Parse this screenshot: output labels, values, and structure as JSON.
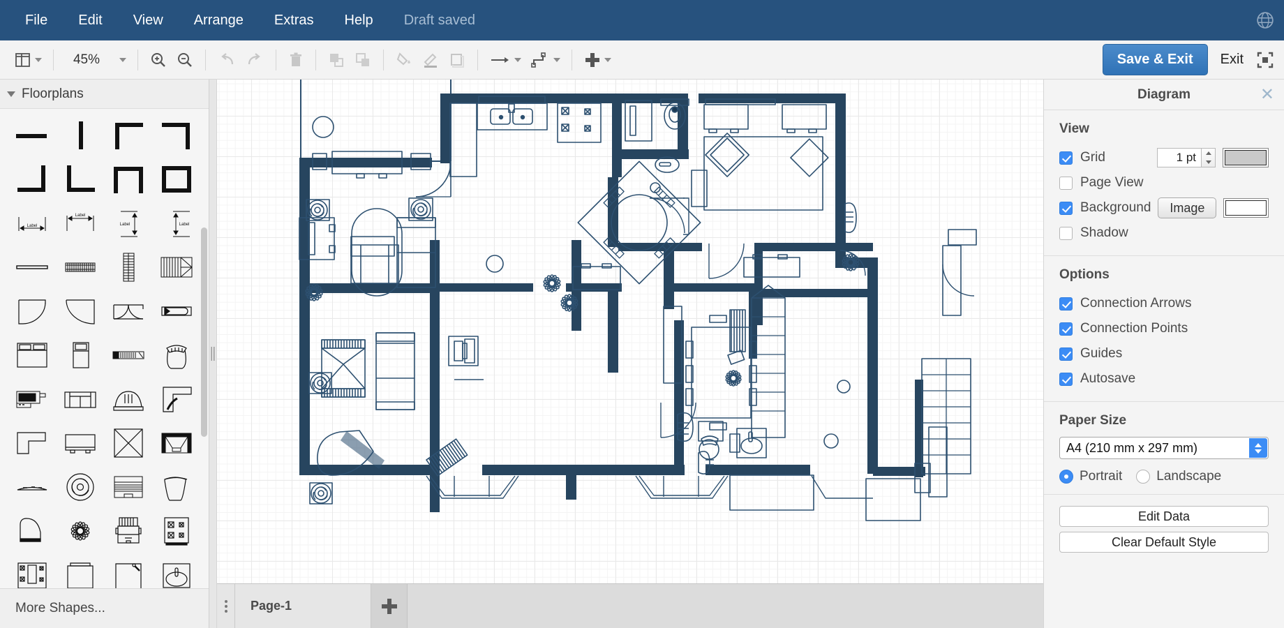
{
  "menu": {
    "items": [
      "File",
      "Edit",
      "View",
      "Arrange",
      "Extras",
      "Help"
    ],
    "status": "Draft saved",
    "globe_icon": "globe-icon"
  },
  "toolbar": {
    "view_icon": "layout-panel-icon",
    "zoom_level": "45%",
    "zoom_in_icon": "zoom-in-icon",
    "zoom_out_icon": "zoom-out-icon",
    "undo_icon": "undo-icon",
    "redo_icon": "redo-icon",
    "delete_icon": "trash-icon",
    "to_front_icon": "bring-to-front-icon",
    "to_back_icon": "send-to-back-icon",
    "fill_icon": "fill-color-icon",
    "line_icon": "line-color-icon",
    "shadow_icon": "shape-style-icon",
    "connection_icon": "connection-arrow-icon",
    "waypoint_icon": "waypoint-icon",
    "insert_icon": "plus-icon",
    "save_exit_label": "Save & Exit",
    "exit_label": "Exit",
    "fullscreen_icon": "fullscreen-icon"
  },
  "sidebar": {
    "palette_title": "Floorplans",
    "more_shapes_label": "More Shapes...",
    "shapes": [
      "wall-horizontal",
      "wall-vertical",
      "wall-corner-left",
      "wall-corner-right",
      "wall-corner-bottom-left",
      "wall-corner-bottom-right",
      "wall-u-shape",
      "wall-room",
      "dimension-bottom",
      "dimension-top",
      "dimension-left",
      "dimension-right",
      "wall-thin",
      "stairs-small",
      "stairs-tall",
      "stairs-winder",
      "door-quarter",
      "door-arc",
      "door-double",
      "window-sliding",
      "bed-double",
      "bed-single",
      "sofa-long",
      "chair-round",
      "tv-stand",
      "sofa-two-seat",
      "armchair",
      "counter-corner",
      "desk-corner",
      "tv-flat",
      "table-square",
      "sofa-sectional",
      "table-low",
      "fan-ceiling",
      "piano-upright",
      "chair-wide",
      "piano-grand",
      "plant-flower",
      "printer",
      "stove-top",
      "kitchen-unit",
      "cabinet",
      "sink-corner",
      "sink-basin"
    ]
  },
  "right_panel": {
    "title": "Diagram",
    "close_icon": "close-icon",
    "view": {
      "heading": "View",
      "grid_label": "Grid",
      "grid_checked": true,
      "grid_size": "1 pt",
      "grid_color": "#c9c9c9",
      "page_view_label": "Page View",
      "page_view_checked": false,
      "background_label": "Background",
      "background_checked": true,
      "background_image_label": "Image",
      "background_color": "#ffffff",
      "shadow_label": "Shadow",
      "shadow_checked": false
    },
    "options": {
      "heading": "Options",
      "items": [
        {
          "label": "Connection Arrows",
          "checked": true
        },
        {
          "label": "Connection Points",
          "checked": true
        },
        {
          "label": "Guides",
          "checked": true
        },
        {
          "label": "Autosave",
          "checked": true
        }
      ]
    },
    "paper": {
      "heading": "Paper Size",
      "selected": "A4 (210 mm x 297 mm)",
      "orientation_portrait": "Portrait",
      "orientation_landscape": "Landscape",
      "portrait_selected": true
    },
    "actions": {
      "edit_data": "Edit Data",
      "clear_default_style": "Clear Default Style"
    }
  },
  "footer": {
    "page_menu_icon": "page-menu-icon",
    "page_tab_label": "Page-1",
    "add_page_icon": "add-page-icon"
  },
  "canvas": {
    "drawing_name": "house-floorplan",
    "wall_color": "#27455f",
    "furniture_stroke": "#2d5070",
    "grid_minor_color": "#f4f4f4",
    "grid_major_color": "#e9e9e9",
    "background": "#ffffff"
  },
  "colors": {
    "menubar": "#27527e",
    "accent_blue": "#3c8cf5",
    "toolbar_bg": "#f3f3f3",
    "panel_bg": "#f4f4f4"
  }
}
